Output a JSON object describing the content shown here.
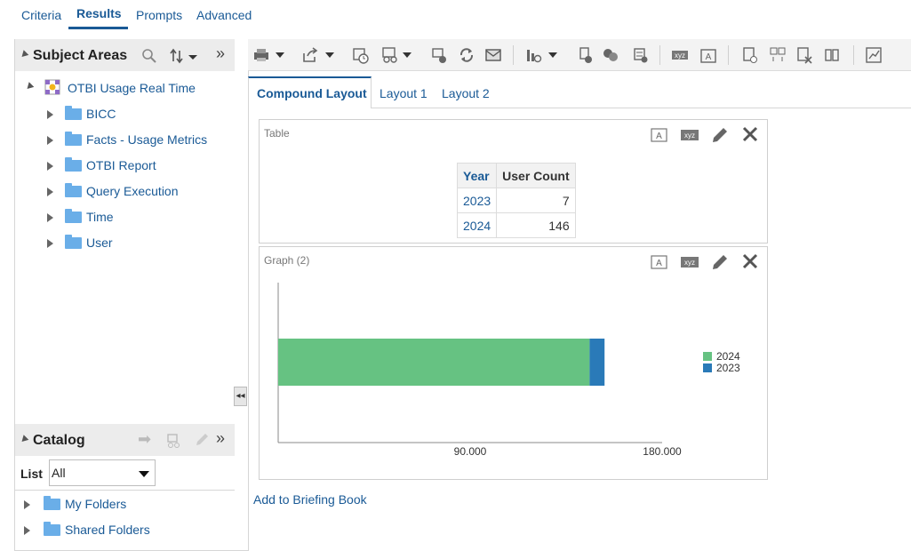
{
  "top_tabs": [
    {
      "label": "Criteria",
      "active": false
    },
    {
      "label": "Results",
      "active": true
    },
    {
      "label": "Prompts",
      "active": false
    },
    {
      "label": "Advanced",
      "active": false
    }
  ],
  "subject_areas": {
    "title": "Subject Areas",
    "root": "OTBI Usage Real Time",
    "items": [
      "BICC",
      "Facts - Usage Metrics",
      "OTBI Report",
      "Query Execution",
      "Time",
      "User"
    ]
  },
  "catalog": {
    "title": "Catalog",
    "list_label": "List",
    "list_value": "All",
    "items": [
      "My Folders",
      "Shared Folders"
    ]
  },
  "layout_tabs": [
    {
      "label": "Compound Layout",
      "active": true
    },
    {
      "label": "Layout 1",
      "active": false
    },
    {
      "label": "Layout 2",
      "active": false
    }
  ],
  "table_view": {
    "title": "Table",
    "headers": [
      "Year",
      "User Count"
    ],
    "rows": [
      {
        "year": "2023",
        "count": "7"
      },
      {
        "year": "2024",
        "count": "146"
      }
    ]
  },
  "graph_view": {
    "title": "Graph (2)",
    "xlabel_icons": [
      "xyz"
    ]
  },
  "chart_data": {
    "type": "bar",
    "orientation": "horizontal",
    "stacked": true,
    "categories": [
      ""
    ],
    "series": [
      {
        "name": "2024",
        "values": [
          146
        ],
        "color": "#66c282"
      },
      {
        "name": "2023",
        "values": [
          7
        ],
        "color": "#2a7ab8"
      }
    ],
    "xlim": [
      0,
      180
    ],
    "xticks": [
      "90.000",
      "180.000"
    ],
    "legend": "right"
  },
  "footer_link": "Add to Briefing Book",
  "colors": {
    "link": "#1a5a96",
    "accent_green": "#66c282",
    "accent_blue": "#2a7ab8"
  }
}
